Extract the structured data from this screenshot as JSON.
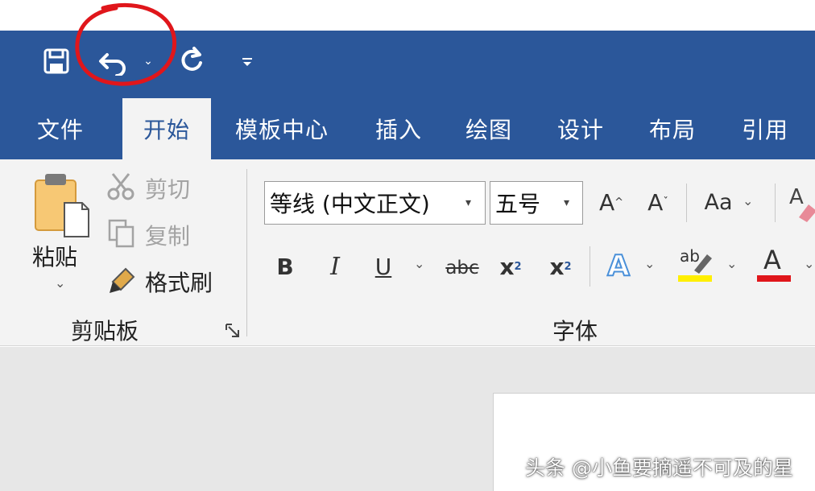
{
  "quick_access": {
    "save_icon": "save-icon",
    "undo_icon": "undo-icon",
    "undo_dropdown_icon": "chevron-down-icon",
    "redo_icon": "redo-icon",
    "customize_icon": "customize-qat-icon"
  },
  "tabs": [
    {
      "label": "文件"
    },
    {
      "label": "开始",
      "active": true
    },
    {
      "label": "模板中心"
    },
    {
      "label": "插入"
    },
    {
      "label": "绘图"
    },
    {
      "label": "设计"
    },
    {
      "label": "布局"
    },
    {
      "label": "引用"
    }
  ],
  "clipboard": {
    "paste_label": "粘贴",
    "cut_label": "剪切",
    "copy_label": "复制",
    "format_painter_label": "格式刷",
    "group_label": "剪贴板"
  },
  "font": {
    "font_name": "等线 (中文正文)",
    "font_size": "五号",
    "grow_label": "A",
    "shrink_label": "A",
    "change_case_label": "Aa",
    "bold": "B",
    "italic": "I",
    "underline": "U",
    "strikethrough": "abc",
    "subscript_base": "x",
    "subscript_mark": "2",
    "superscript_base": "x",
    "superscript_mark": "2",
    "text_effect": "A",
    "highlight_label": "ab",
    "font_color_label": "A",
    "clear_format_label": "A",
    "group_label": "字体"
  },
  "colors": {
    "title_bar": "#2b579a",
    "annotation_circle": "#e0161b",
    "highlight_yellow": "#ffef00",
    "font_color_red": "#e0161b",
    "text_effect_blue": "#4a90d9"
  },
  "watermark": "头条 @小鱼要摘遥不可及的星"
}
